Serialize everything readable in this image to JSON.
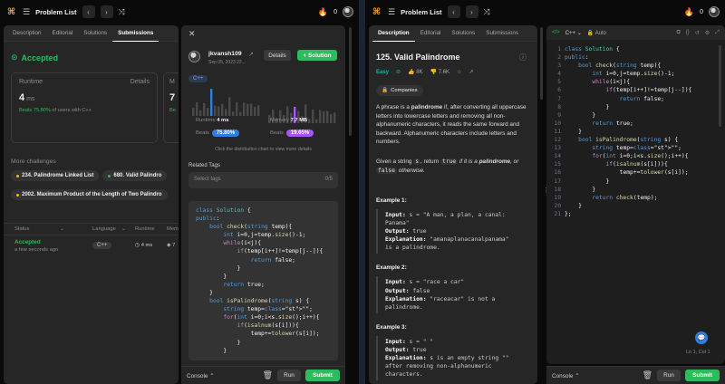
{
  "topbar": {
    "title": "Problem List",
    "streak": "0"
  },
  "left": {
    "tabs": [
      "Description",
      "Editorial",
      "Solutions",
      "Submissions"
    ],
    "accepted": "Accepted",
    "runtime_label": "Runtime",
    "details_label": "Details",
    "runtime_value": "4",
    "runtime_unit": "ms",
    "beats_text": "Beats 75.80%",
    "beats_suffix": "of users with C++",
    "memory_initial": "M",
    "memory_digit": "7",
    "memory_beats": "Be",
    "more_challenges": "More challenges",
    "challenges": [
      {
        "label": "234. Palindrome Linked List",
        "color": "#ffb800"
      },
      {
        "label": "680. Valid Palindro",
        "color": "#2cbb5d"
      },
      {
        "label": "2002. Maximum Product of the Length of Two Palindro",
        "color": "#ffb800"
      }
    ],
    "table_headers": {
      "status": "Status",
      "language": "Language",
      "runtime": "Runtime",
      "memory": "Mem"
    },
    "row": {
      "status": "Accepted",
      "time": "a few seconds ago",
      "language": "C++",
      "runtime": "4 ms",
      "memory": "7"
    }
  },
  "detail": {
    "username": "jkvansh109",
    "date": "Sep 05, 2023 22...",
    "details_btn": "Details",
    "solution_btn": "Solution",
    "lang": "C++",
    "runtime_label": "Runtime",
    "runtime_value": "4 ms",
    "memory_label": "Memory",
    "memory_value": "7.7 MB",
    "beats_label": "Beats",
    "beats_runtime": "75.80%",
    "beats_memory": "19.65%",
    "hint": "Click the distribution chart to view more details",
    "tags_title": "Related Tags",
    "tags_placeholder": "Select tags",
    "tags_count": "0/5",
    "code": [
      "class Solution {",
      "public:",
      "    bool check(string temp){",
      "        int i=0,j=temp.size()-1;",
      "        while(i<j){",
      "            if(temp[i++]!=temp[j--]){",
      "                return false;",
      "            }",
      "        }",
      "        return true;",
      "    }",
      "    bool isPalindrome(string s) {",
      "        string temp=\"\";",
      "        for(int i=0;i<s.size();i++){",
      "            if(isalnum(s[i])){",
      "                temp+=tolower(s[i]);",
      "            }",
      "        }"
    ]
  },
  "bottom": {
    "console": "Console",
    "run": "Run",
    "submit": "Submit"
  },
  "right": {
    "tabs": [
      "Description",
      "Editorial",
      "Solutions",
      "Submissions"
    ],
    "title": "125. Valid Palindrome",
    "difficulty": "Easy",
    "likes": "8K",
    "dislikes": "7.6K",
    "companies": "Companies",
    "para1_a": "A phrase is a ",
    "para1_b": "palindrome",
    "para1_c": " if, after converting all uppercase letters into lowercase letters and removing all non-alphanumeric characters, it reads the same forward and backward. Alphanumeric characters include letters and numbers.",
    "para2_a": "Given a string ",
    "para2_s": "s",
    "para2_b": ", return ",
    "para2_true": "true",
    "para2_c": " if it is a ",
    "para2_d": "palindrome",
    "para2_e": ", or ",
    "para2_false": "false",
    "para2_f": " otherwise.",
    "examples": [
      {
        "title": "Example 1:",
        "lines": [
          [
            "Input:",
            " s = \"A man, a plan, a canal:"
          ],
          [
            "",
            "Panama\""
          ],
          [
            "Output:",
            " true"
          ],
          [
            "Explanation:",
            " \"amanaplanacanalpanama\""
          ],
          [
            "",
            "is a palindrome."
          ]
        ]
      },
      {
        "title": "Example 2:",
        "lines": [
          [
            "Input:",
            " s = \"race a car\""
          ],
          [
            "Output:",
            " false"
          ],
          [
            "Explanation:",
            " \"raceacar\" is not a"
          ],
          [
            "",
            "palindrome."
          ]
        ]
      },
      {
        "title": "Example 3:",
        "lines": [
          [
            "Input:",
            " s = \" \""
          ],
          [
            "Output:",
            " true"
          ],
          [
            "Explanation:",
            " s is an empty string \"\""
          ],
          [
            "",
            "after removing non-alphanumeric"
          ],
          [
            "",
            "characters."
          ]
        ]
      }
    ],
    "editor_lang": "C++",
    "auto": "Auto",
    "code": [
      "class Solution {",
      "public:",
      "    bool check(string temp){",
      "        int i=0,j=temp.size()-1;",
      "        while(i<j){",
      "            if(temp[i++]!=temp[j--]){",
      "                return false;",
      "            }",
      "        }",
      "        return true;",
      "    }",
      "    bool isPalindrome(string s) {",
      "        string temp=\"\";",
      "        for(int i=0;i<s.size();i++){",
      "            if(isalnum(s[i])){",
      "                temp+=tolower(s[i]);",
      "            }",
      "        }",
      "        return check(temp);",
      "    }",
      "};"
    ],
    "cursor": "Ln 1, Col 1"
  },
  "colors": {
    "accent": "#2cbb5d",
    "runtime_bar": "#2f7de1",
    "memory_bar": "#a855f7",
    "easy": "#00b8a3"
  }
}
